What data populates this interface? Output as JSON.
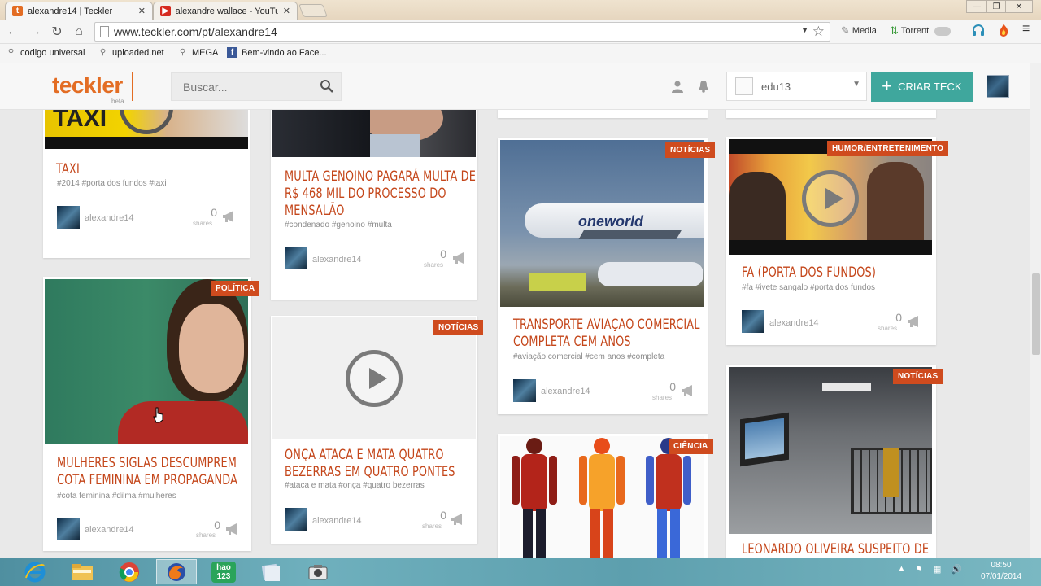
{
  "browser": {
    "tabs": [
      {
        "label": "alexandre14 | Teckler",
        "favicon": "t"
      },
      {
        "label": "alexandre wallace - YouTu",
        "favicon": "youtube"
      }
    ],
    "url": "www.teckler.com/pt/alexandre14",
    "extensions": [
      {
        "label": "Media"
      },
      {
        "label": "Torrent"
      }
    ],
    "bookmarks": [
      {
        "label": "codigo universal"
      },
      {
        "label": "uploaded.net"
      },
      {
        "label": "MEGA"
      },
      {
        "label": "Bem-vindo ao Face..."
      }
    ]
  },
  "header": {
    "logo": "teckler",
    "logo_beta": "beta",
    "search_placeholder": "Buscar...",
    "user_select_value": "edu13",
    "create_label": "CRIAR TECK",
    "accent_color": "#3fa79d",
    "brand_color": "#e36d24"
  },
  "cards": [
    {
      "title_lines": [
        "TAXI"
      ],
      "tags": "#2014  #porta dos fundos  #taxi",
      "author": "alexandre14",
      "shares": "0",
      "shares_label": "shares",
      "category": ""
    },
    {
      "title_lines": [
        "MULTA GENOINO PAGARÁ MULTA DE",
        "R$ 468 MIL DO PROCESSO DO",
        "MENSALÃO"
      ],
      "tags": "#condenado  #genoino  #multa",
      "author": "alexandre14",
      "shares": "0",
      "shares_label": "shares",
      "category": ""
    },
    {
      "title_lines": [
        "TRANSPORTE AVIAÇÃO COMERCIAL",
        "COMPLETA CEM ANOS"
      ],
      "tags": "#aviação comercial  #cem anos  #completa",
      "author": "alexandre14",
      "shares": "0",
      "shares_label": "shares",
      "category": "NOTÍCIAS",
      "image_text": "oneworld"
    },
    {
      "title_lines": [
        "FA (PORTA DOS FUNDOS)"
      ],
      "tags": "#fa  #ivete sangalo  #porta dos fundos",
      "author": "alexandre14",
      "shares": "0",
      "shares_label": "shares",
      "category": "HUMOR/ENTRETENIMENTO"
    },
    {
      "title_lines": [
        "MULHERES SIGLAS DESCUMPREM",
        "COTA FEMININA EM PROPAGANDA"
      ],
      "tags": "#cota feminina  #dilma  #mulheres",
      "author": "alexandre14",
      "shares": "0",
      "shares_label": "shares",
      "category": "POLÍTICA"
    },
    {
      "title_lines": [
        "ONÇA ATACA E MATA QUATRO",
        "BEZERRAS EM QUATRO PONTES"
      ],
      "tags": "#ataca e mata  #onça  #quatro bezerras",
      "author": "alexandre14",
      "shares": "0",
      "shares_label": "shares",
      "category": "NOTÍCIAS"
    },
    {
      "title_lines": [],
      "category": "CIÊNCIA"
    },
    {
      "title_lines": [
        "LEONARDO OLIVEIRA SUSPEITO DE"
      ],
      "category": "NOTÍCIAS"
    }
  ],
  "taskbar": {
    "time": "08:50",
    "date": "07/01/2014",
    "apps": [
      "ie",
      "explorer",
      "chrome",
      "firefox",
      "hao123",
      "files",
      "camera"
    ]
  }
}
